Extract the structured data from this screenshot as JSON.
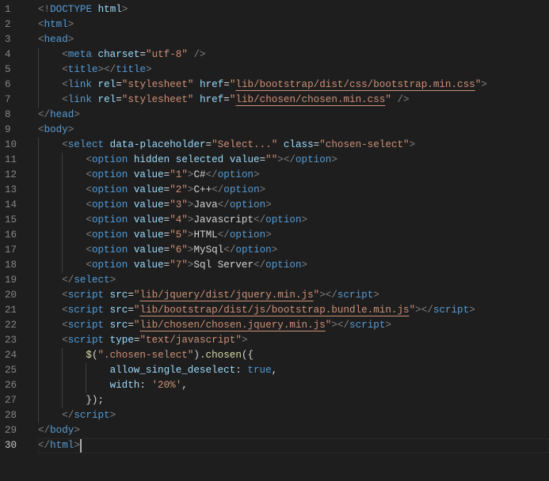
{
  "editor": {
    "active_line": 30,
    "colors": {
      "background": "#1e1e1e",
      "tag": "#569cd6",
      "attribute": "#9cdcfe",
      "string": "#ce9178",
      "punctuation": "#808080",
      "text": "#d4d4d4",
      "function": "#dcdcaa"
    },
    "lines": [
      {
        "indent": 0,
        "tokens": [
          [
            "p",
            "<!"
          ],
          [
            "t",
            "DOCTYPE"
          ],
          [
            "x",
            " "
          ],
          [
            "a",
            "html"
          ],
          [
            "p",
            ">"
          ]
        ]
      },
      {
        "indent": 0,
        "tokens": [
          [
            "p",
            "<"
          ],
          [
            "t",
            "html"
          ],
          [
            "p",
            ">"
          ]
        ]
      },
      {
        "indent": 0,
        "tokens": [
          [
            "p",
            "<"
          ],
          [
            "t",
            "head"
          ],
          [
            "p",
            ">"
          ]
        ]
      },
      {
        "indent": 1,
        "tokens": [
          [
            "p",
            "<"
          ],
          [
            "t",
            "meta"
          ],
          [
            "x",
            " "
          ],
          [
            "a",
            "charset"
          ],
          [
            "x",
            "="
          ],
          [
            "s",
            "\"utf-8\""
          ],
          [
            "x",
            " "
          ],
          [
            "p",
            "/>"
          ]
        ]
      },
      {
        "indent": 1,
        "tokens": [
          [
            "p",
            "<"
          ],
          [
            "t",
            "title"
          ],
          [
            "p",
            "></"
          ],
          [
            "t",
            "title"
          ],
          [
            "p",
            ">"
          ]
        ]
      },
      {
        "indent": 1,
        "tokens": [
          [
            "p",
            "<"
          ],
          [
            "t",
            "link"
          ],
          [
            "x",
            " "
          ],
          [
            "a",
            "rel"
          ],
          [
            "x",
            "="
          ],
          [
            "s",
            "\"stylesheet\""
          ],
          [
            "x",
            " "
          ],
          [
            "a",
            "href"
          ],
          [
            "x",
            "="
          ],
          [
            "s",
            "\""
          ],
          [
            "u",
            "lib/bootstrap/dist/css/bootstrap.min.css"
          ],
          [
            "s",
            "\""
          ],
          [
            "p",
            ">"
          ]
        ]
      },
      {
        "indent": 1,
        "tokens": [
          [
            "p",
            "<"
          ],
          [
            "t",
            "link"
          ],
          [
            "x",
            " "
          ],
          [
            "a",
            "rel"
          ],
          [
            "x",
            "="
          ],
          [
            "s",
            "\"stylesheet\""
          ],
          [
            "x",
            " "
          ],
          [
            "a",
            "href"
          ],
          [
            "x",
            "="
          ],
          [
            "s",
            "\""
          ],
          [
            "u",
            "lib/chosen/chosen.min.css"
          ],
          [
            "s",
            "\""
          ],
          [
            "x",
            " "
          ],
          [
            "p",
            "/>"
          ]
        ]
      },
      {
        "indent": 0,
        "tokens": [
          [
            "p",
            "</"
          ],
          [
            "t",
            "head"
          ],
          [
            "p",
            ">"
          ]
        ]
      },
      {
        "indent": 0,
        "tokens": [
          [
            "p",
            "<"
          ],
          [
            "t",
            "body"
          ],
          [
            "p",
            ">"
          ]
        ]
      },
      {
        "indent": 1,
        "tokens": [
          [
            "p",
            "<"
          ],
          [
            "t",
            "select"
          ],
          [
            "x",
            " "
          ],
          [
            "a",
            "data-placeholder"
          ],
          [
            "x",
            "="
          ],
          [
            "s",
            "\"Select...\""
          ],
          [
            "x",
            " "
          ],
          [
            "a",
            "class"
          ],
          [
            "x",
            "="
          ],
          [
            "s",
            "\"chosen-select\""
          ],
          [
            "p",
            ">"
          ]
        ]
      },
      {
        "indent": 2,
        "tokens": [
          [
            "p",
            "<"
          ],
          [
            "t",
            "option"
          ],
          [
            "x",
            " "
          ],
          [
            "a",
            "hidden"
          ],
          [
            "x",
            " "
          ],
          [
            "a",
            "selected"
          ],
          [
            "x",
            " "
          ],
          [
            "a",
            "value"
          ],
          [
            "x",
            "="
          ],
          [
            "s",
            "\"\""
          ],
          [
            "p",
            "></"
          ],
          [
            "t",
            "option"
          ],
          [
            "p",
            ">"
          ]
        ]
      },
      {
        "indent": 2,
        "tokens": [
          [
            "p",
            "<"
          ],
          [
            "t",
            "option"
          ],
          [
            "x",
            " "
          ],
          [
            "a",
            "value"
          ],
          [
            "x",
            "="
          ],
          [
            "s",
            "\"1\""
          ],
          [
            "p",
            ">"
          ],
          [
            "x",
            "C#"
          ],
          [
            "p",
            "</"
          ],
          [
            "t",
            "option"
          ],
          [
            "p",
            ">"
          ]
        ]
      },
      {
        "indent": 2,
        "tokens": [
          [
            "p",
            "<"
          ],
          [
            "t",
            "option"
          ],
          [
            "x",
            " "
          ],
          [
            "a",
            "value"
          ],
          [
            "x",
            "="
          ],
          [
            "s",
            "\"2\""
          ],
          [
            "p",
            ">"
          ],
          [
            "x",
            "C++"
          ],
          [
            "p",
            "</"
          ],
          [
            "t",
            "option"
          ],
          [
            "p",
            ">"
          ]
        ]
      },
      {
        "indent": 2,
        "tokens": [
          [
            "p",
            "<"
          ],
          [
            "t",
            "option"
          ],
          [
            "x",
            " "
          ],
          [
            "a",
            "value"
          ],
          [
            "x",
            "="
          ],
          [
            "s",
            "\"3\""
          ],
          [
            "p",
            ">"
          ],
          [
            "x",
            "Java"
          ],
          [
            "p",
            "</"
          ],
          [
            "t",
            "option"
          ],
          [
            "p",
            ">"
          ]
        ]
      },
      {
        "indent": 2,
        "tokens": [
          [
            "p",
            "<"
          ],
          [
            "t",
            "option"
          ],
          [
            "x",
            " "
          ],
          [
            "a",
            "value"
          ],
          [
            "x",
            "="
          ],
          [
            "s",
            "\"4\""
          ],
          [
            "p",
            ">"
          ],
          [
            "x",
            "Javascript"
          ],
          [
            "p",
            "</"
          ],
          [
            "t",
            "option"
          ],
          [
            "p",
            ">"
          ]
        ]
      },
      {
        "indent": 2,
        "tokens": [
          [
            "p",
            "<"
          ],
          [
            "t",
            "option"
          ],
          [
            "x",
            " "
          ],
          [
            "a",
            "value"
          ],
          [
            "x",
            "="
          ],
          [
            "s",
            "\"5\""
          ],
          [
            "p",
            ">"
          ],
          [
            "x",
            "HTML"
          ],
          [
            "p",
            "</"
          ],
          [
            "t",
            "option"
          ],
          [
            "p",
            ">"
          ]
        ]
      },
      {
        "indent": 2,
        "tokens": [
          [
            "p",
            "<"
          ],
          [
            "t",
            "option"
          ],
          [
            "x",
            " "
          ],
          [
            "a",
            "value"
          ],
          [
            "x",
            "="
          ],
          [
            "s",
            "\"6\""
          ],
          [
            "p",
            ">"
          ],
          [
            "x",
            "MySql"
          ],
          [
            "p",
            "</"
          ],
          [
            "t",
            "option"
          ],
          [
            "p",
            ">"
          ]
        ]
      },
      {
        "indent": 2,
        "tokens": [
          [
            "p",
            "<"
          ],
          [
            "t",
            "option"
          ],
          [
            "x",
            " "
          ],
          [
            "a",
            "value"
          ],
          [
            "x",
            "="
          ],
          [
            "s",
            "\"7\""
          ],
          [
            "p",
            ">"
          ],
          [
            "x",
            "Sql Server"
          ],
          [
            "p",
            "</"
          ],
          [
            "t",
            "option"
          ],
          [
            "p",
            ">"
          ]
        ]
      },
      {
        "indent": 1,
        "tokens": [
          [
            "p",
            "</"
          ],
          [
            "t",
            "select"
          ],
          [
            "p",
            ">"
          ]
        ]
      },
      {
        "indent": 1,
        "tokens": [
          [
            "p",
            "<"
          ],
          [
            "t",
            "script"
          ],
          [
            "x",
            " "
          ],
          [
            "a",
            "src"
          ],
          [
            "x",
            "="
          ],
          [
            "s",
            "\""
          ],
          [
            "u",
            "lib/jquery/dist/jquery.min.js"
          ],
          [
            "s",
            "\""
          ],
          [
            "p",
            "></"
          ],
          [
            "t",
            "script"
          ],
          [
            "p",
            ">"
          ]
        ]
      },
      {
        "indent": 1,
        "tokens": [
          [
            "p",
            "<"
          ],
          [
            "t",
            "script"
          ],
          [
            "x",
            " "
          ],
          [
            "a",
            "src"
          ],
          [
            "x",
            "="
          ],
          [
            "s",
            "\""
          ],
          [
            "u",
            "lib/bootstrap/dist/js/bootstrap.bundle.min.js"
          ],
          [
            "s",
            "\""
          ],
          [
            "p",
            "></"
          ],
          [
            "t",
            "script"
          ],
          [
            "p",
            ">"
          ]
        ]
      },
      {
        "indent": 1,
        "tokens": [
          [
            "p",
            "<"
          ],
          [
            "t",
            "script"
          ],
          [
            "x",
            " "
          ],
          [
            "a",
            "src"
          ],
          [
            "x",
            "="
          ],
          [
            "s",
            "\""
          ],
          [
            "u",
            "lib/chosen/chosen.jquery.min.js"
          ],
          [
            "s",
            "\""
          ],
          [
            "p",
            "></"
          ],
          [
            "t",
            "script"
          ],
          [
            "p",
            ">"
          ]
        ]
      },
      {
        "indent": 1,
        "tokens": [
          [
            "p",
            "<"
          ],
          [
            "t",
            "script"
          ],
          [
            "x",
            " "
          ],
          [
            "a",
            "type"
          ],
          [
            "x",
            "="
          ],
          [
            "s",
            "\"text/javascript\""
          ],
          [
            "p",
            ">"
          ]
        ]
      },
      {
        "indent": 2,
        "tokens": [
          [
            "f",
            "$"
          ],
          [
            "x",
            "("
          ],
          [
            "s",
            "\".chosen-select\""
          ],
          [
            "x",
            ")."
          ],
          [
            "f",
            "chosen"
          ],
          [
            "x",
            "({"
          ]
        ]
      },
      {
        "indent": 3,
        "tokens": [
          [
            "a",
            "allow_single_deselect"
          ],
          [
            "x",
            ": "
          ],
          [
            "k",
            "true"
          ],
          [
            "x",
            ","
          ]
        ]
      },
      {
        "indent": 3,
        "tokens": [
          [
            "a",
            "width"
          ],
          [
            "x",
            ": "
          ],
          [
            "s",
            "'20%'"
          ],
          [
            "x",
            ","
          ]
        ]
      },
      {
        "indent": 2,
        "tokens": [
          [
            "x",
            "});"
          ]
        ]
      },
      {
        "indent": 1,
        "tokens": [
          [
            "p",
            "</"
          ],
          [
            "t",
            "script"
          ],
          [
            "p",
            ">"
          ]
        ]
      },
      {
        "indent": 0,
        "tokens": [
          [
            "p",
            "</"
          ],
          [
            "t",
            "body"
          ],
          [
            "p",
            ">"
          ]
        ]
      },
      {
        "indent": 0,
        "tokens": [
          [
            "p",
            "</"
          ],
          [
            "t",
            "html"
          ],
          [
            "p",
            ">"
          ]
        ]
      }
    ]
  }
}
